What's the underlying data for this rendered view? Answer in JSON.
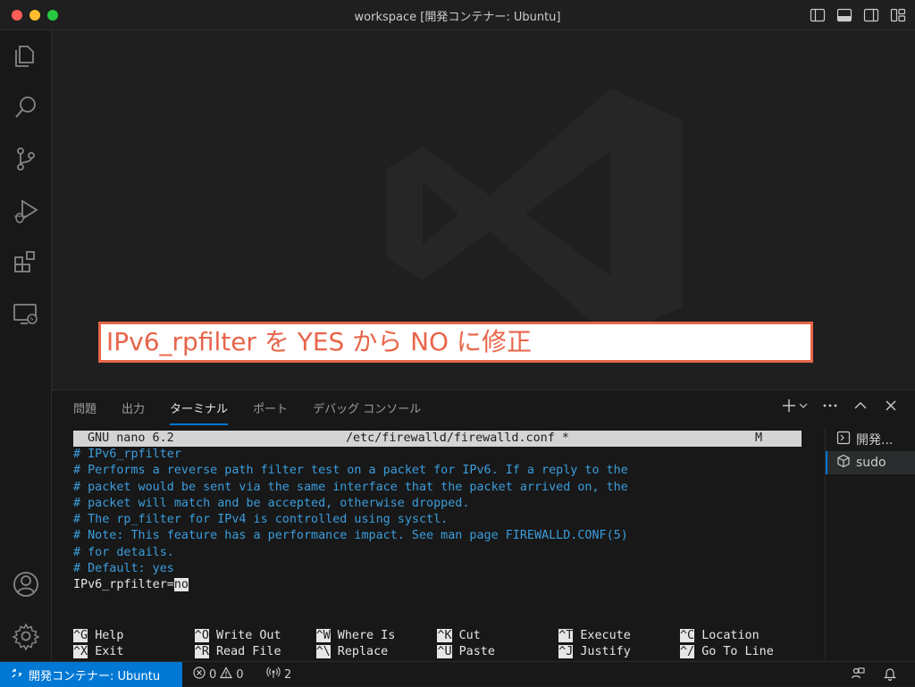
{
  "window": {
    "title": "workspace [開発コンテナー: Ubuntu]",
    "layout_icons": [
      "toggle-primary-sidebar-icon",
      "toggle-panel-icon",
      "toggle-secondary-sidebar-icon",
      "customize-layout-icon"
    ]
  },
  "activity_bar": {
    "top_items": [
      "explorer-icon",
      "search-icon",
      "source-control-icon",
      "run-debug-icon",
      "extensions-icon",
      "remote-explorer-icon"
    ],
    "bottom_items": [
      "accounts-icon",
      "manage-gear-icon"
    ]
  },
  "annotation": {
    "text": "IPv6_rpfilter を YES から NO に修正",
    "color": "#e8654a"
  },
  "panel": {
    "tabs": [
      {
        "label": "問題",
        "active": false
      },
      {
        "label": "出力",
        "active": false
      },
      {
        "label": "ターミナル",
        "active": true
      },
      {
        "label": "ポート",
        "active": false
      },
      {
        "label": "デバッグ コンソール",
        "active": false
      }
    ],
    "actions": [
      "new-terminal-icon",
      "terminal-dropdown-icon",
      "more-actions-icon",
      "maximize-panel-icon",
      "close-panel-icon"
    ]
  },
  "terminal": {
    "header": {
      "left": "GNU nano 6.2",
      "center": "/etc/firewalld/firewalld.conf *",
      "right": "M"
    },
    "lines": [
      "# IPv6_rpfilter",
      "# Performs a reverse path filter test on a packet for IPv6. If a reply to the",
      "# packet would be sent via the same interface that the packet arrived on, the",
      "# packet will match and be accepted, otherwise dropped.",
      "# The rp_filter for IPv4 is controlled using sysctl.",
      "# Note: This feature has a performance impact. See man page FIREWALLD.CONF(5)",
      "# for details.",
      "# Default: yes"
    ],
    "setting_key": "IPv6_rpfilter=",
    "setting_value": "no",
    "shortcuts": [
      {
        "key": "^G",
        "label": "Help"
      },
      {
        "key": "^O",
        "label": "Write Out"
      },
      {
        "key": "^W",
        "label": "Where Is"
      },
      {
        "key": "^K",
        "label": "Cut"
      },
      {
        "key": "^T",
        "label": "Execute"
      },
      {
        "key": "^C",
        "label": "Location"
      },
      {
        "key": "^X",
        "label": "Exit"
      },
      {
        "key": "^R",
        "label": "Read File"
      },
      {
        "key": "^\\",
        "label": "Replace"
      },
      {
        "key": "^U",
        "label": "Paste"
      },
      {
        "key": "^J",
        "label": "Justify"
      },
      {
        "key": "^/",
        "label": "Go To Line"
      }
    ],
    "comment_color": "#3b9ddd"
  },
  "terminal_list": [
    {
      "label": "開発...",
      "icon": "terminal-icon",
      "selected": false
    },
    {
      "label": "sudo",
      "icon": "container-icon",
      "selected": true
    }
  ],
  "status_bar": {
    "remote_label": "開発コンテナー: Ubuntu",
    "remote_color": "#0078d4",
    "errors": "0",
    "warnings": "0",
    "ports": "2"
  }
}
